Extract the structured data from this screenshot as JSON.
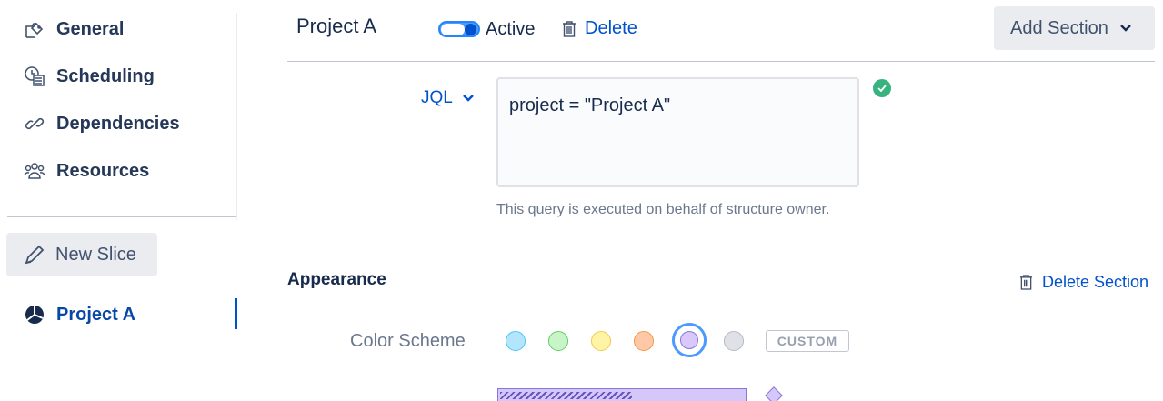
{
  "sidebar": {
    "items": [
      {
        "label": "General",
        "icon": "general-settings-icon"
      },
      {
        "label": "Scheduling",
        "icon": "calendar-clock-icon"
      },
      {
        "label": "Dependencies",
        "icon": "link-icon"
      },
      {
        "label": "Resources",
        "icon": "people-icon"
      }
    ],
    "new_slice": {
      "label": "New Slice",
      "icon": "pencil-icon"
    },
    "project": {
      "label": "Project A",
      "icon": "pie-slice-icon"
    }
  },
  "header": {
    "title": "Project A",
    "active_label": "Active",
    "active": true,
    "delete_label": "Delete",
    "add_section_label": "Add Section"
  },
  "jql": {
    "mode_label": "JQL",
    "query": "project = \"Project A\"",
    "valid": true,
    "help_text": "This query is executed on behalf of structure owner."
  },
  "appearance": {
    "title": "Appearance",
    "delete_section_label": "Delete Section",
    "color_scheme_label": "Color Scheme",
    "swatches": [
      {
        "name": "blue",
        "fill": "#b3e5fc",
        "stroke": "#4fc3f7"
      },
      {
        "name": "green",
        "fill": "#c8f5c8",
        "stroke": "#66cc66"
      },
      {
        "name": "yellow",
        "fill": "#fff3a6",
        "stroke": "#f2c94c"
      },
      {
        "name": "orange",
        "fill": "#ffc9a8",
        "stroke": "#f2994a"
      },
      {
        "name": "purple",
        "fill": "#d8c8fc",
        "stroke": "#8777d9",
        "selected": true
      },
      {
        "name": "gray",
        "fill": "#dfe1e6",
        "stroke": "#b3bac5"
      }
    ],
    "custom_label": "CUSTOM"
  },
  "colors": {
    "link": "#0052cc",
    "success": "#36b37e",
    "selection_ring": "#4c9aff"
  }
}
